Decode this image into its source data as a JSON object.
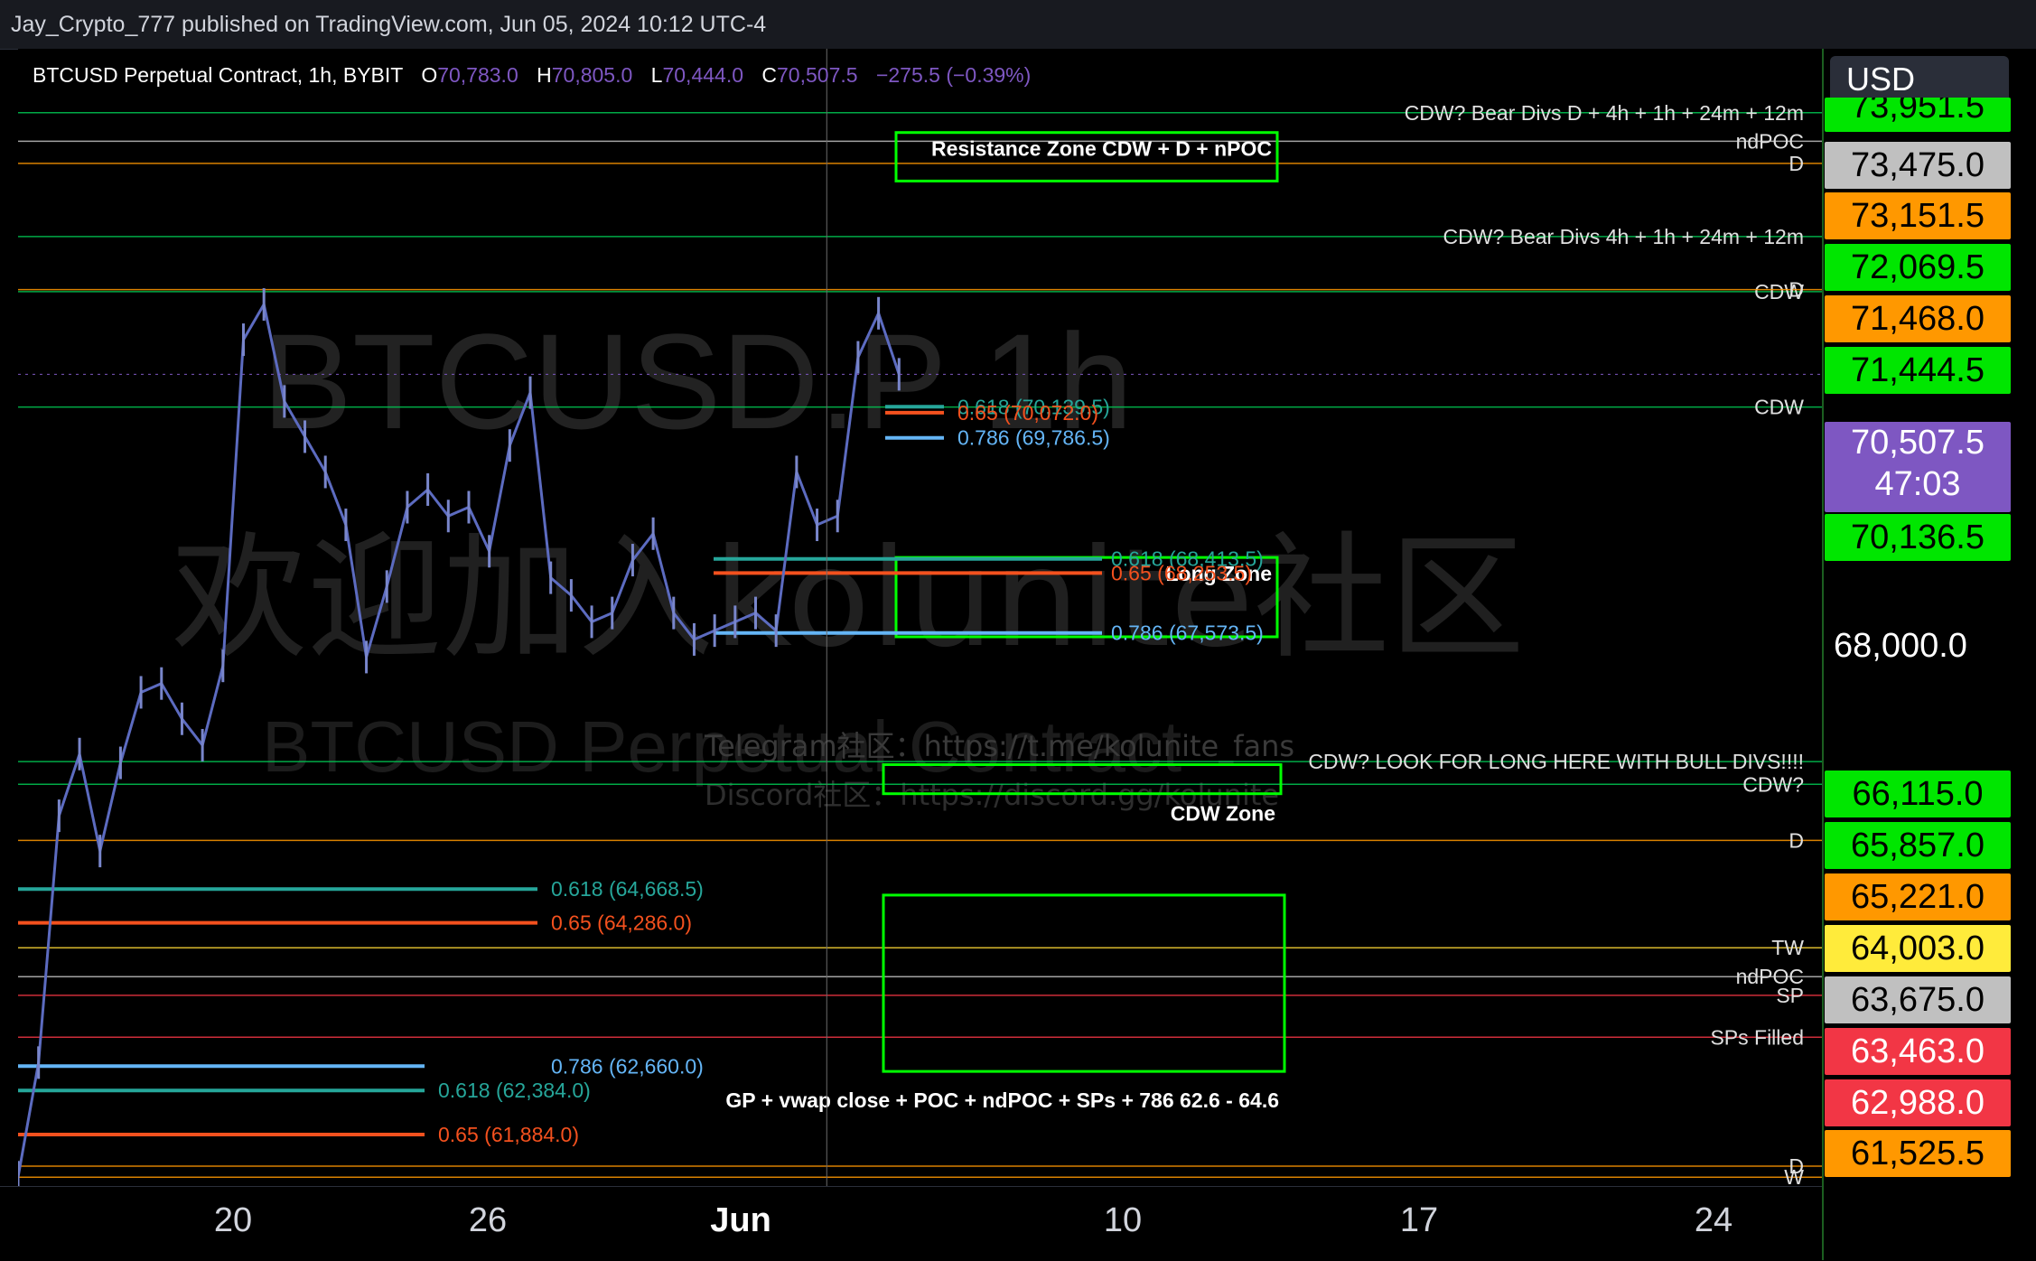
{
  "publisher": "Jay_Crypto_777 published on TradingView.com, Jun 05, 2024 10:12 UTC-4",
  "symbol": {
    "name": "BTCUSD Perpetual Contract, 1h, BYBIT",
    "open_label": "O",
    "open": "70,783.0",
    "high_label": "H",
    "high": "70,805.0",
    "low_label": "L",
    "low": "70,444.0",
    "close_label": "C",
    "close": "70,507.5",
    "change": "−275.5 (−0.39%)"
  },
  "currency": "USD",
  "watermark": {
    "line1": "BTCUSD.P 1h",
    "line2": "欢迎加入kolunite社区",
    "line3": "BTCUSD Perpetual Contract",
    "telegram": "Telegram社区：https://t.me/kolunite_fans",
    "discord": "Discord社区：https://discord.gg/kolunite"
  },
  "price_axis": {
    "tags": [
      {
        "label": "73,951.5",
        "bg": "#00e600",
        "partial": true
      },
      {
        "label": "73,475.0",
        "bg": "#c0c0c0"
      },
      {
        "label": "73,151.5",
        "bg": "#ff9800"
      },
      {
        "label": "72,069.5",
        "bg": "#00e600"
      },
      {
        "label": "71,468.0",
        "bg": "#ff9800"
      },
      {
        "label": "71,444.5",
        "bg": "#00e600"
      },
      {
        "label": "70,507.5",
        "countdown": "47:03",
        "bg": "#7e57c2"
      },
      {
        "label": "70,136.5",
        "bg": "#00e600"
      },
      {
        "label": "68,000.0",
        "plain": true
      },
      {
        "label": "66,115.0",
        "bg": "#00e600"
      },
      {
        "label": "65,857.0",
        "bg": "#00e600"
      },
      {
        "label": "65,221.0",
        "bg": "#ff9800"
      },
      {
        "label": "64,003.0",
        "bg": "#ffeb3b"
      },
      {
        "label": "63,675.0",
        "bg": "#c0c0c0"
      },
      {
        "label": "63,463.0",
        "bg": "#f23645"
      },
      {
        "label": "62,988.0",
        "bg": "#f23645"
      },
      {
        "label": "61,525.5",
        "bg": "#ff9800"
      }
    ]
  },
  "time_axis": {
    "labels": [
      {
        "text": "20",
        "bold": false
      },
      {
        "text": "26",
        "bold": false
      },
      {
        "text": "Jun",
        "bold": true
      },
      {
        "text": "10",
        "bold": false
      },
      {
        "text": "17",
        "bold": false
      },
      {
        "text": "24",
        "bold": false
      }
    ]
  },
  "chart_data": {
    "type": "line",
    "title": "BTCUSD Perpetual Contract, 1h, BYBIT",
    "y_range": [
      61300,
      74200
    ],
    "x_range_dates": [
      "2024-05-15",
      "2024-06-27"
    ],
    "series": [
      {
        "values": [
          {
            "date": "2024-05-15",
            "close": 61400
          },
          {
            "date": "2024-05-15",
            "close": 62700
          },
          {
            "date": "2024-05-16",
            "close": 65500
          },
          {
            "date": "2024-05-16",
            "close": 66200
          },
          {
            "date": "2024-05-17",
            "close": 65100
          },
          {
            "date": "2024-05-17",
            "close": 66100
          },
          {
            "date": "2024-05-18",
            "close": 66900
          },
          {
            "date": "2024-05-18",
            "close": 67000
          },
          {
            "date": "2024-05-19",
            "close": 66600
          },
          {
            "date": "2024-05-19",
            "close": 66300
          },
          {
            "date": "2024-05-20",
            "close": 67200
          },
          {
            "date": "2024-05-20",
            "close": 70900
          },
          {
            "date": "2024-05-21",
            "close": 71300
          },
          {
            "date": "2024-05-21",
            "close": 70200
          },
          {
            "date": "2024-05-22",
            "close": 69800
          },
          {
            "date": "2024-05-22",
            "close": 69400
          },
          {
            "date": "2024-05-23",
            "close": 68800
          },
          {
            "date": "2024-05-23",
            "close": 67300
          },
          {
            "date": "2024-05-24",
            "close": 68100
          },
          {
            "date": "2024-05-24",
            "close": 69000
          },
          {
            "date": "2024-05-25",
            "close": 69200
          },
          {
            "date": "2024-05-25",
            "close": 68900
          },
          {
            "date": "2024-05-26",
            "close": 69000
          },
          {
            "date": "2024-05-26",
            "close": 68500
          },
          {
            "date": "2024-05-27",
            "close": 69700
          },
          {
            "date": "2024-05-27",
            "close": 70300
          },
          {
            "date": "2024-05-28",
            "close": 68200
          },
          {
            "date": "2024-05-28",
            "close": 68000
          },
          {
            "date": "2024-05-29",
            "close": 67700
          },
          {
            "date": "2024-05-29",
            "close": 67800
          },
          {
            "date": "2024-05-30",
            "close": 68400
          },
          {
            "date": "2024-05-30",
            "close": 68700
          },
          {
            "date": "2024-05-31",
            "close": 67800
          },
          {
            "date": "2024-05-31",
            "close": 67500
          },
          {
            "date": "2024-06-01",
            "close": 67600
          },
          {
            "date": "2024-06-01",
            "close": 67700
          },
          {
            "date": "2024-06-02",
            "close": 67800
          },
          {
            "date": "2024-06-02",
            "close": 67600
          },
          {
            "date": "2024-06-03",
            "close": 69400
          },
          {
            "date": "2024-06-03",
            "close": 68800
          },
          {
            "date": "2024-06-04",
            "close": 68900
          },
          {
            "date": "2024-06-04",
            "close": 70700
          },
          {
            "date": "2024-06-05",
            "close": 71200
          },
          {
            "date": "2024-06-05",
            "close": 70507.5
          }
        ]
      }
    ],
    "levels": [
      {
        "price": 73475.0,
        "label": "CDW? Bear Divs D + 4h + 1h + 24m + 12m",
        "tag": "CDW",
        "color": "#00c853"
      },
      {
        "price": 73151.5,
        "label": "ndPOC",
        "color": "#c0c0c0"
      },
      {
        "price": 72900.0,
        "label": "D",
        "color": "#ff9800"
      },
      {
        "price": 72069.5,
        "label": "CDW? Bear Divs 4h + 1h + 24m + 12m",
        "color": "#00c853"
      },
      {
        "price": 71444.5,
        "label": "CDW",
        "color": "#00c853"
      },
      {
        "price": 71468.0,
        "label": "D",
        "color": "#ff9800"
      },
      {
        "price": 70136.5,
        "label": "CDW",
        "color": "#00c853"
      },
      {
        "price": 66115.0,
        "label": "CDW? LOOK FOR LONG HERE WITH BULL DIVS!!!!",
        "color": "#00c853"
      },
      {
        "price": 65857.0,
        "label": "CDW?",
        "color": "#00c853"
      },
      {
        "price": 65221.0,
        "label": "D",
        "color": "#ff9800"
      },
      {
        "price": 64003.0,
        "label": "TW",
        "color": "#fdd835"
      },
      {
        "price": 63675.0,
        "label": "ndPOC",
        "color": "#c0c0c0"
      },
      {
        "price": 63463.0,
        "label": "SP",
        "color": "#f23645"
      },
      {
        "price": 62988.0,
        "label": "SPs Filled",
        "color": "#f23645"
      },
      {
        "price": 61525.5,
        "label": "D",
        "color": "#ff9800"
      },
      {
        "price": 61400.0,
        "label": "W",
        "color": "#ff9800"
      }
    ],
    "fibs": [
      {
        "price": 70139.5,
        "text": "0.618 (70,139.5)",
        "color": "#26a69a"
      },
      {
        "price": 70072.0,
        "text": "0.65 (70,072.0)",
        "color": "#f4511e"
      },
      {
        "price": 69786.5,
        "text": "0.786 (69,786.5)",
        "color": "#64b5f6"
      },
      {
        "price": 68413.5,
        "text": "0.618 (68,413.5)",
        "color": "#26a69a"
      },
      {
        "price": 68253.5,
        "text": "0.65 (68,253.5)",
        "color": "#f4511e"
      },
      {
        "price": 67573.5,
        "text": "0.786 (67,573.5)",
        "color": "#64b5f6"
      },
      {
        "price": 64668.5,
        "text": "0.618 (64,668.5)",
        "color": "#26a69a"
      },
      {
        "price": 64286.0,
        "text": "0.65 (64,286.0)",
        "color": "#f4511e"
      },
      {
        "price": 62660.0,
        "text": "0.786 (62,660.0)",
        "color": "#64b5f6"
      },
      {
        "price": 62384.0,
        "text": "0.618 (62,384.0)",
        "color": "#26a69a"
      },
      {
        "price": 61884.0,
        "text": "0.65 (61,884.0)",
        "color": "#f4511e"
      }
    ],
    "zones": [
      {
        "label": "Resistance Zone CDW + D + nPOC",
        "top": 73250,
        "bottom": 72700
      },
      {
        "label": "Long Zone",
        "top": 68430,
        "bottom": 67530
      },
      {
        "label": "CDW Zone",
        "top": 66080,
        "bottom": 65750
      },
      {
        "label": "GP + vwap close + POC + ndPOC + SPs + 786 62.6 - 64.6",
        "top": 64600,
        "bottom": 62600
      }
    ]
  }
}
